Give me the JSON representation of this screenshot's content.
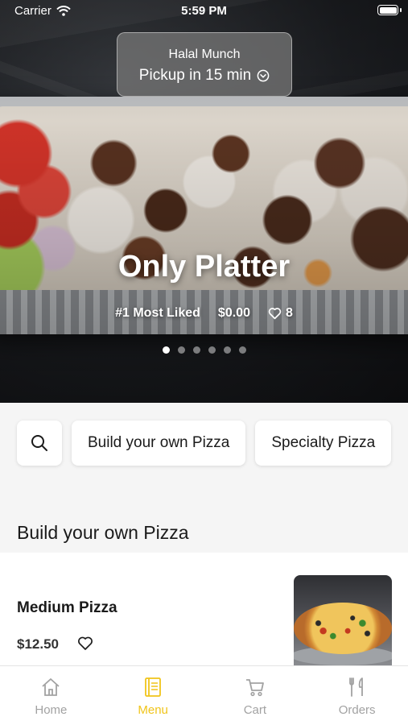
{
  "status_bar": {
    "carrier": "Carrier",
    "time": "5:59 PM"
  },
  "store": {
    "name": "Halal Munch",
    "pickup": "Pickup in 15 min"
  },
  "hero": {
    "title": "Only Platter",
    "rank": "#1 Most Liked",
    "price": "$0.00",
    "likes": "8",
    "slides_total": 6,
    "active_slide": 1
  },
  "categories": [
    {
      "label": "Build your own Pizza"
    },
    {
      "label": "Specialty Pizza"
    }
  ],
  "section": {
    "title": "Build your own Pizza"
  },
  "item": {
    "name": "Medium Pizza",
    "price": "$12.50"
  },
  "tabs": [
    {
      "label": "Home",
      "icon": "home-icon"
    },
    {
      "label": "Menu",
      "icon": "menu-icon"
    },
    {
      "label": "Cart",
      "icon": "cart-icon"
    },
    {
      "label": "Orders",
      "icon": "orders-icon"
    }
  ],
  "colors": {
    "accent": "#f0c419",
    "inactive_tab": "#a2a2a2"
  }
}
